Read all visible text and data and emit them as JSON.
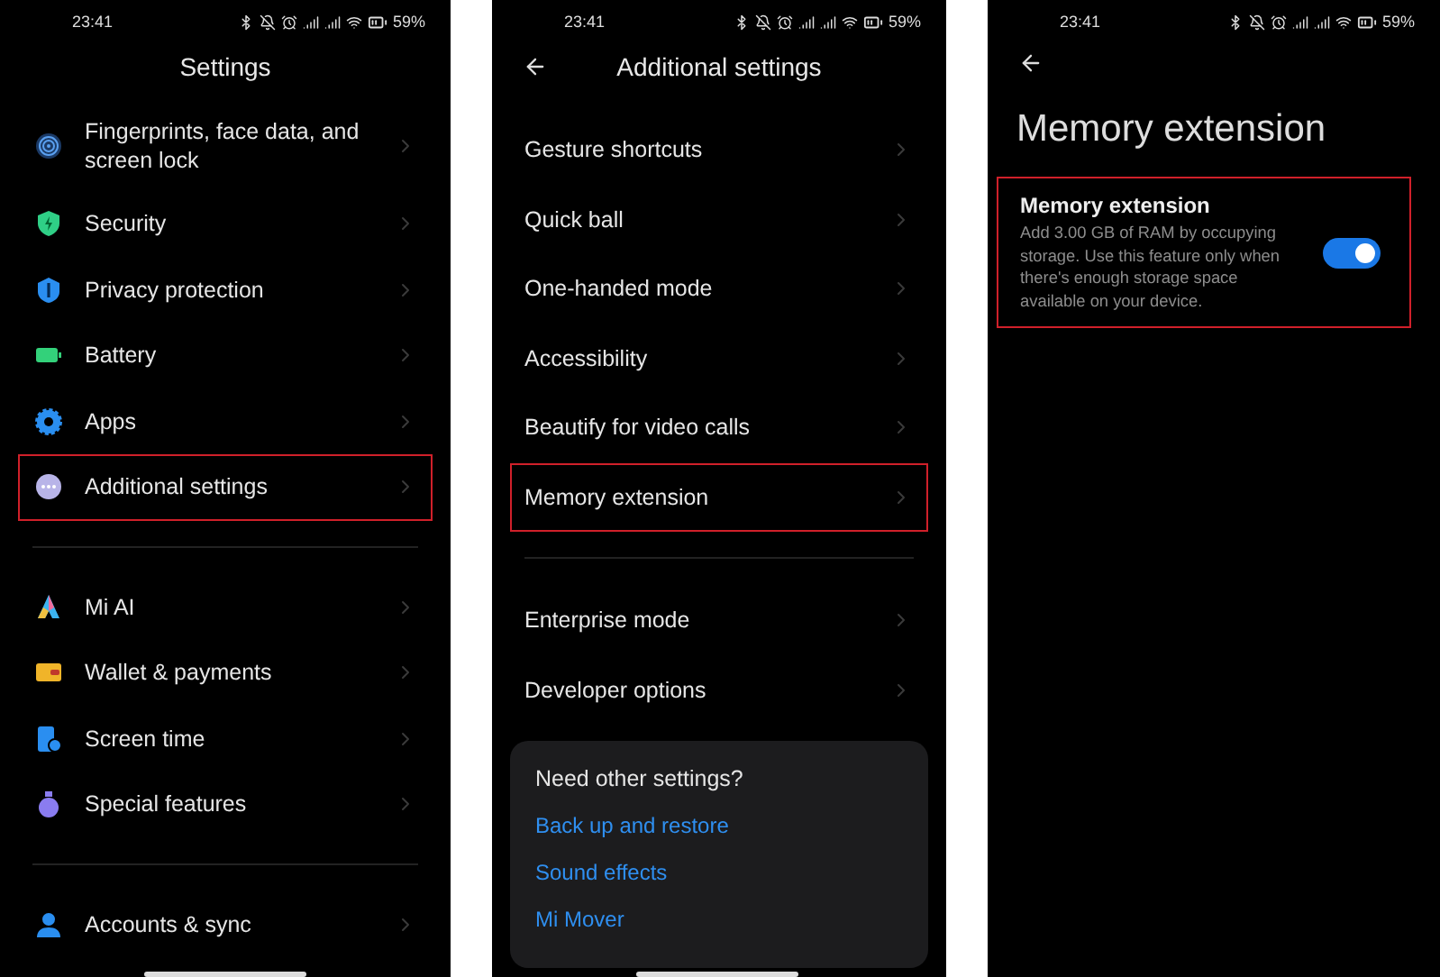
{
  "screens": [
    {
      "kind": "main",
      "status_bar": {
        "time": "23:41",
        "battery": "59%"
      },
      "title": "Settings",
      "groups": [
        [
          {
            "label": "Fingerprints, face data, and screen lock",
            "highlighted": false
          },
          {
            "label": "Security",
            "highlighted": false
          },
          {
            "label": "Privacy protection",
            "highlighted": false
          },
          {
            "label": "Battery",
            "highlighted": false
          },
          {
            "label": "Apps",
            "highlighted": false
          },
          {
            "label": "Additional settings",
            "highlighted": true
          }
        ],
        [
          {
            "label": "Mi AI",
            "highlighted": false
          },
          {
            "label": "Wallet & payments",
            "highlighted": false
          },
          {
            "label": "Screen time",
            "highlighted": false
          },
          {
            "label": "Special features",
            "highlighted": false
          }
        ],
        [
          {
            "label": "Accounts & sync",
            "highlighted": false
          }
        ]
      ]
    },
    {
      "kind": "sub",
      "status_bar": {
        "time": "23:41",
        "battery": "59%"
      },
      "title": "Additional settings",
      "groups": [
        [
          {
            "label": "Gesture shortcuts",
            "highlighted": false
          },
          {
            "label": "Quick ball",
            "highlighted": false
          },
          {
            "label": "One-handed mode",
            "highlighted": false
          },
          {
            "label": "Accessibility",
            "highlighted": false
          },
          {
            "label": "Beautify for video calls",
            "highlighted": false
          },
          {
            "label": "Memory extension",
            "highlighted": true
          }
        ],
        [
          {
            "label": "Enterprise mode",
            "highlighted": false
          },
          {
            "label": "Developer options",
            "highlighted": false
          }
        ]
      ],
      "card": {
        "title": "Need other settings?",
        "links": [
          "Back up and restore",
          "Sound effects",
          "Mi Mover"
        ]
      }
    },
    {
      "kind": "detail",
      "status_bar": {
        "time": "23:41",
        "battery": "59%"
      },
      "title": "Memory extension",
      "toggle": {
        "label": "Memory extension",
        "description": "Add 3.00 GB of RAM by occupying storage. Use this feature only when there's enough storage space available on your device.",
        "on": true,
        "highlighted": true
      }
    }
  ]
}
